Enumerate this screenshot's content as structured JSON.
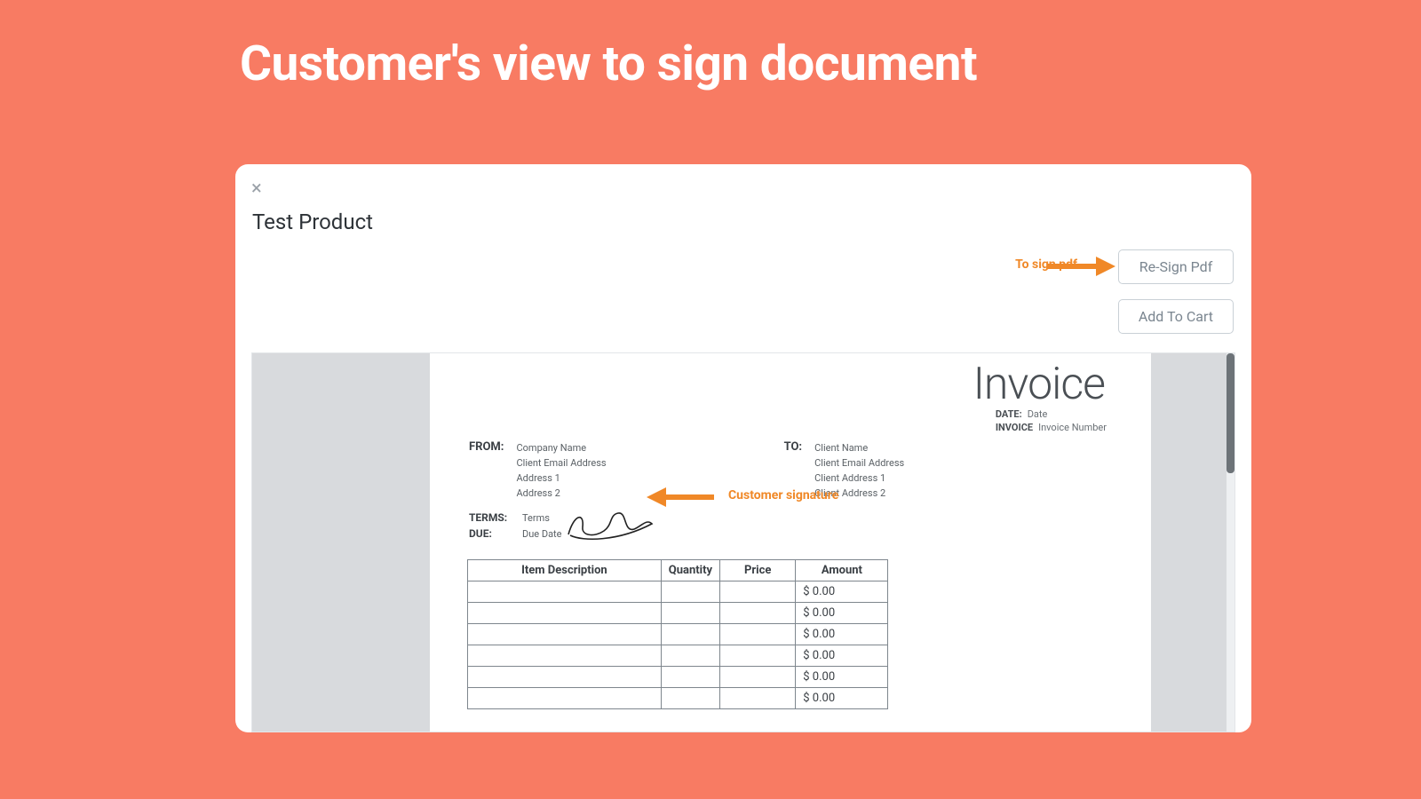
{
  "slide_title": "Customer's view to sign document",
  "modal": {
    "close_glyph": "×",
    "product_title": "Test Product",
    "buttons": {
      "resign": "Re-Sign Pdf",
      "add_to_cart": "Add To Cart"
    },
    "annotations": {
      "to_sign": "To sign pdf",
      "signature": "Customer signature"
    }
  },
  "invoice": {
    "title": "Invoice",
    "meta": {
      "date_label": "DATE:",
      "date_value": "Date",
      "number_label": "INVOICE",
      "number_value": "Invoice Number"
    },
    "from": {
      "label": "FROM:",
      "lines": [
        "Company Name",
        "Client Email Address",
        "Address 1",
        "Address 2"
      ]
    },
    "to": {
      "label": "TO:",
      "lines": [
        "Client Name",
        "Client Email Address",
        "Client Address 1",
        "Client Address 2"
      ]
    },
    "terms": {
      "terms_label": "TERMS:",
      "terms_value": "Terms",
      "due_label": "DUE:",
      "due_value": "Due Date"
    },
    "table": {
      "headers": {
        "desc": "Item Description",
        "qty": "Quantity",
        "price": "Price",
        "amount": "Amount"
      },
      "rows": [
        {
          "amount": "$ 0.00"
        },
        {
          "amount": "$ 0.00"
        },
        {
          "amount": "$ 0.00"
        },
        {
          "amount": "$ 0.00"
        },
        {
          "amount": "$ 0.00"
        },
        {
          "amount": "$ 0.00"
        }
      ]
    }
  }
}
